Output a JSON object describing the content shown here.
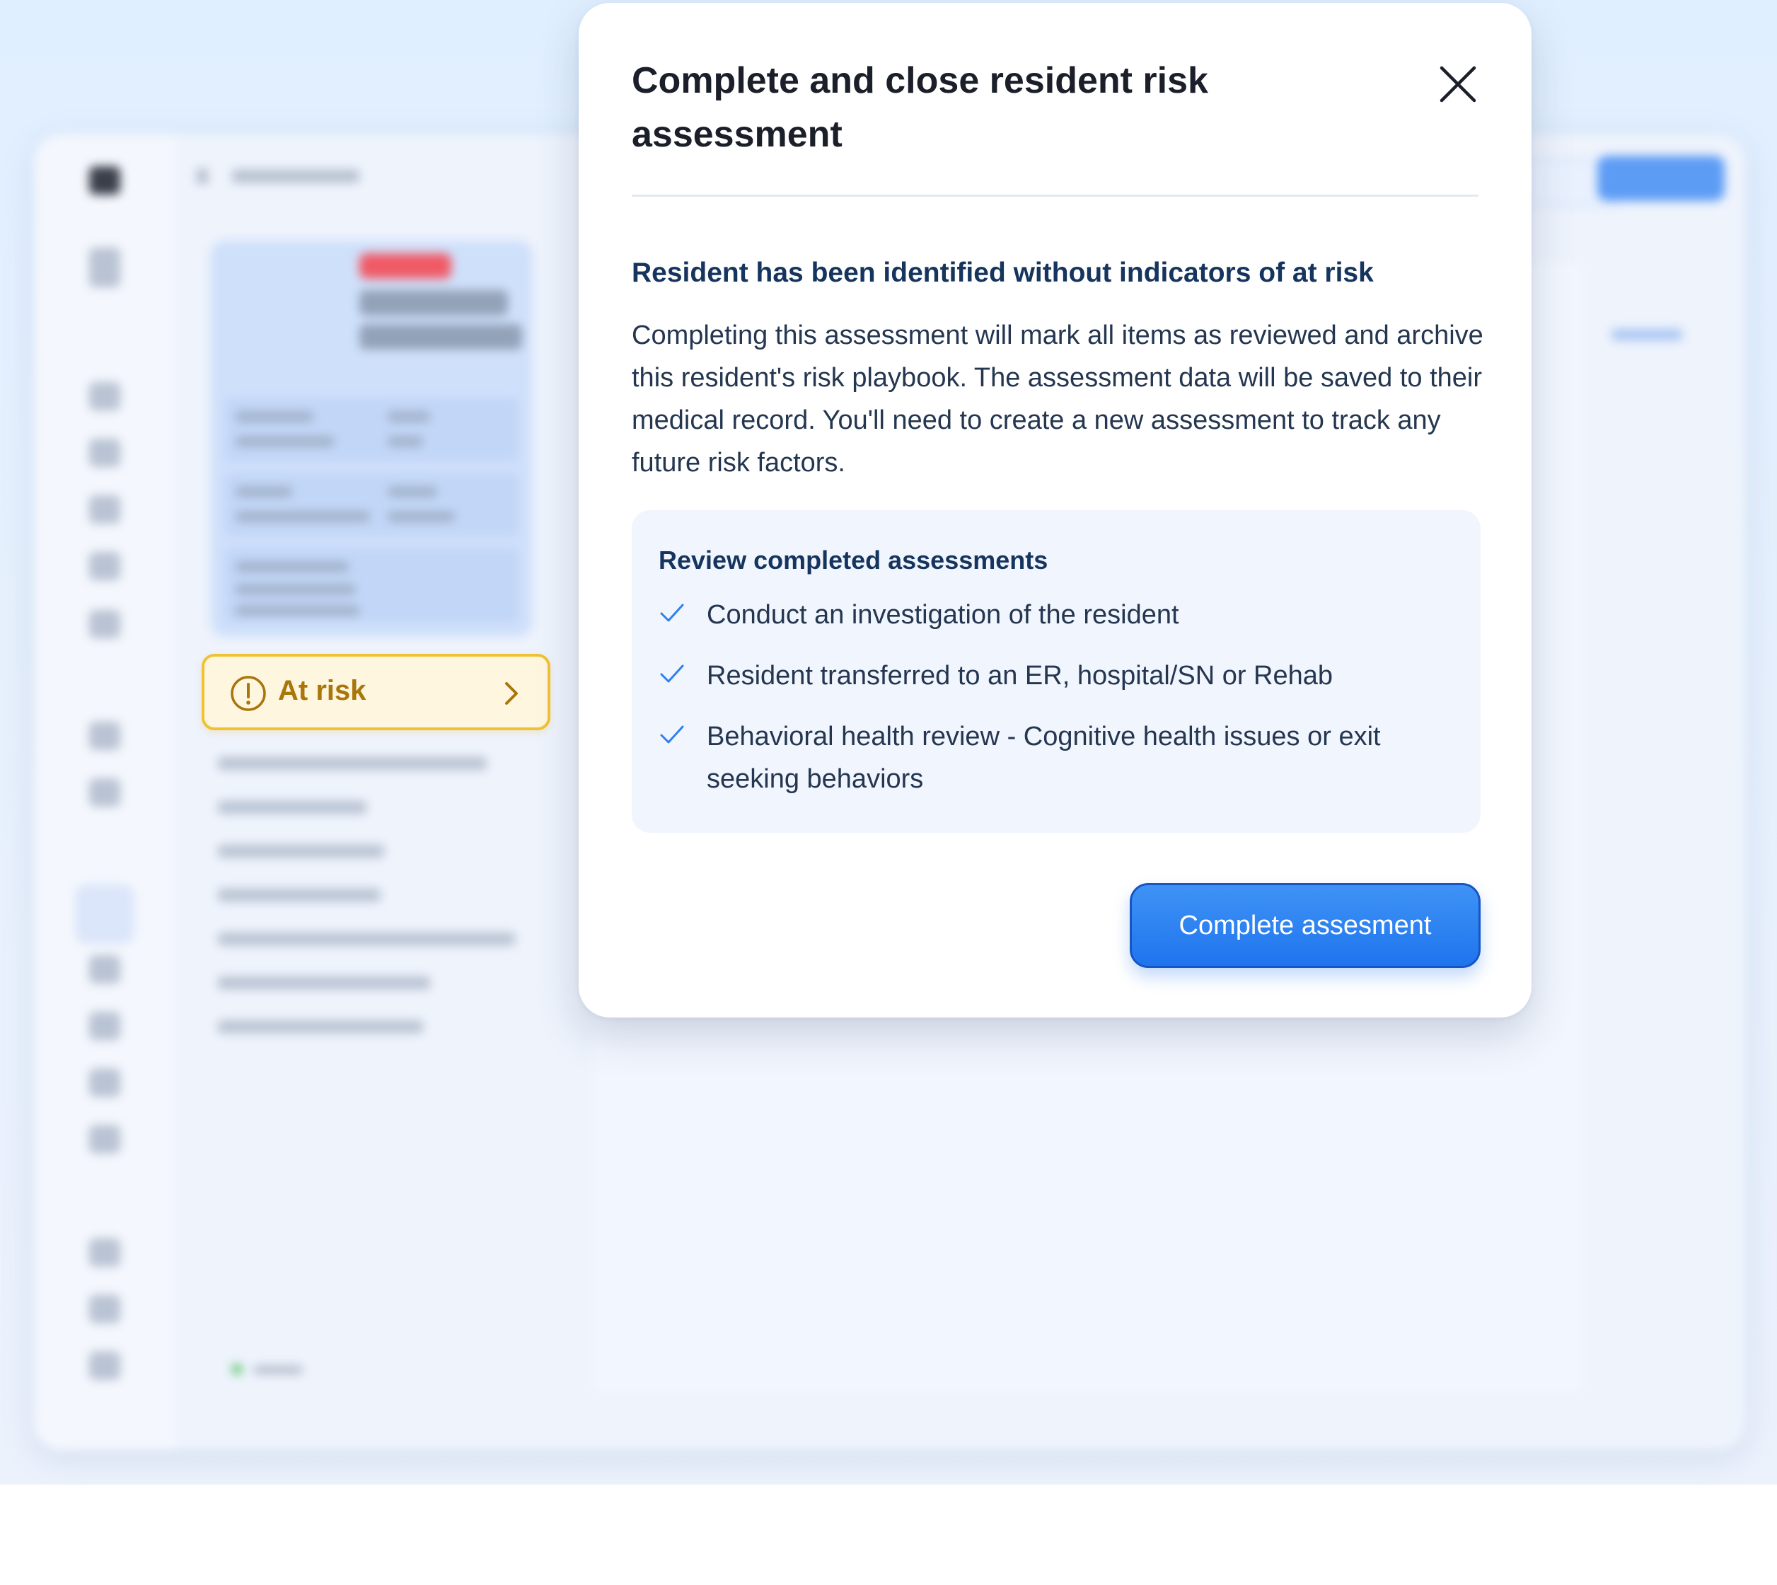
{
  "status_chip": {
    "label": "At risk",
    "icon": "exclamation-circle-icon",
    "chevron_icon": "chevron-right-icon"
  },
  "modal": {
    "title": "Complete and close resident risk assessment",
    "close_icon": "close-icon",
    "subheading": "Resident has been identified without indicators of at risk",
    "description": "Completing this assessment will mark all items as reviewed and archive this resident's risk playbook. The assessment data will be saved to their medical record. You'll need to create a new assessment to track any future risk factors.",
    "review": {
      "title": "Review completed assessments",
      "items": [
        {
          "label": "Conduct an investigation of the resident",
          "checked": true
        },
        {
          "label": "Resident transferred to an ER, hospital/SN or Rehab",
          "checked": true
        },
        {
          "label": "Behavioral health review - Cognitive health issues or exit seeking behaviors",
          "checked": true
        }
      ]
    },
    "primary_button": "Complete assesment"
  },
  "colors": {
    "accent_blue": "#1f74ee",
    "warning_yellow": "#f0c233",
    "warning_text": "#a8760a",
    "heading_navy": "#16355e"
  }
}
